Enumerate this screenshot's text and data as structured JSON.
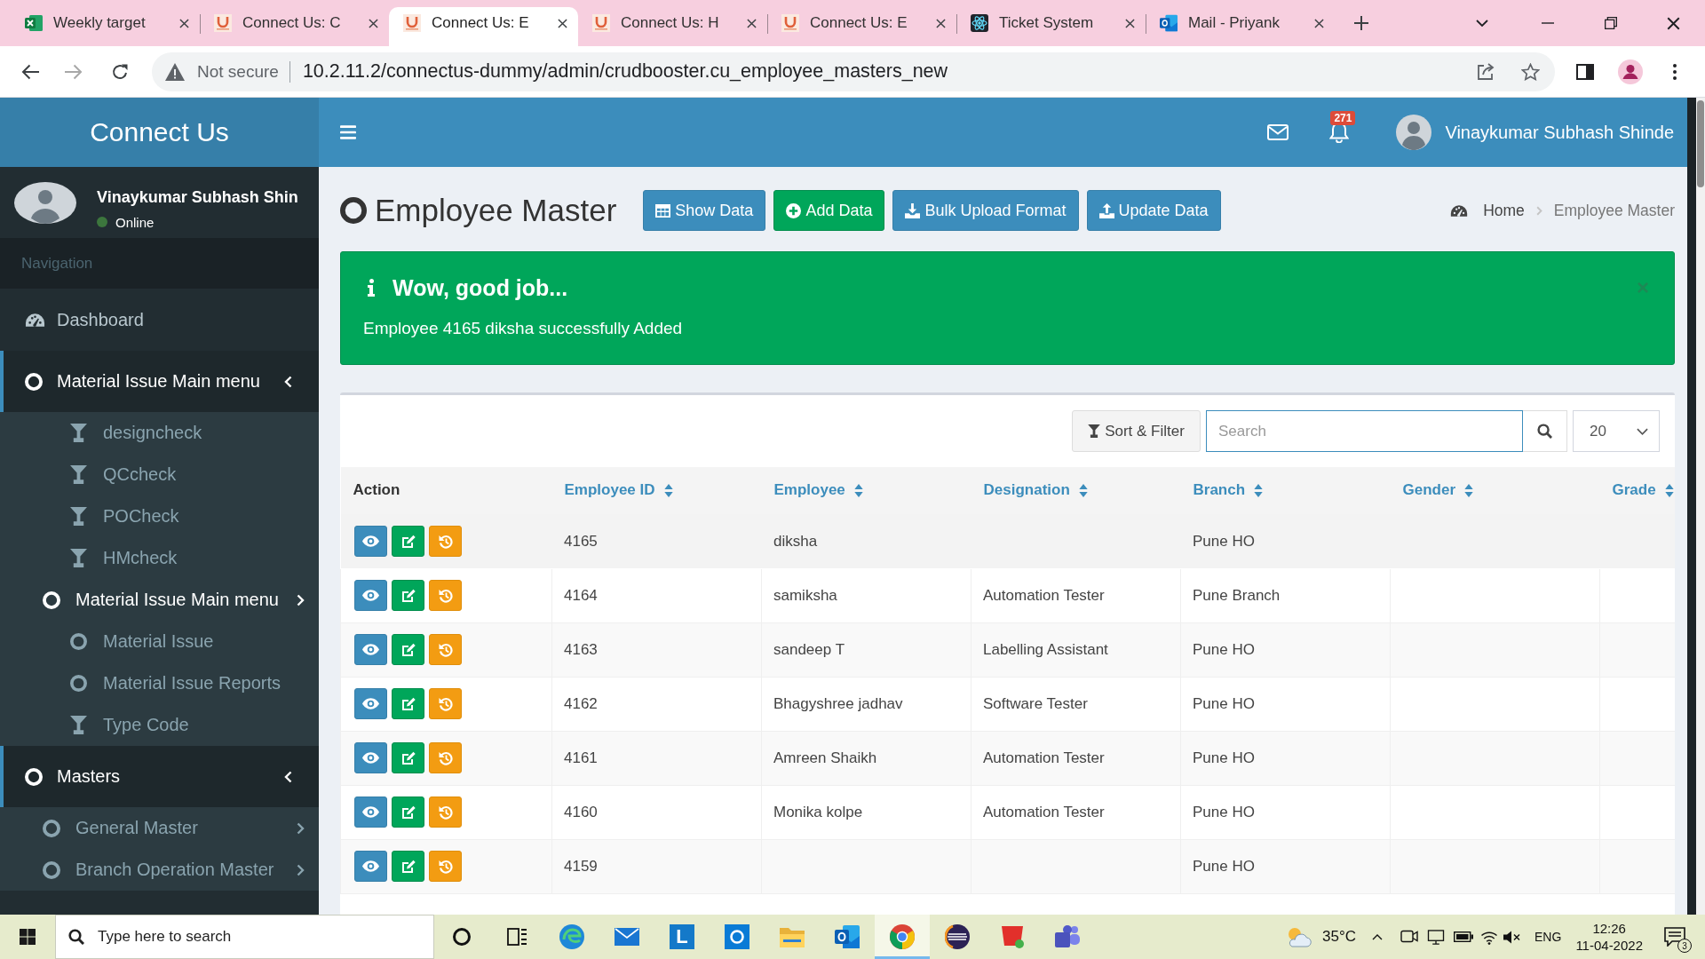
{
  "browser": {
    "tabs": [
      {
        "title": "Weekly target",
        "kind": "sheet",
        "selected": false
      },
      {
        "title": "Connect Us: C",
        "kind": "portal",
        "selected": false
      },
      {
        "title": "Connect Us: E",
        "kind": "portal",
        "selected": true
      },
      {
        "title": "Connect Us: H",
        "kind": "portal",
        "selected": false
      },
      {
        "title": "Connect Us: E",
        "kind": "portal",
        "selected": false
      },
      {
        "title": "Ticket System",
        "kind": "atom",
        "selected": false
      },
      {
        "title": "Mail - Priyank",
        "kind": "mail",
        "selected": false
      }
    ],
    "security": "Not secure",
    "url": "10.2.11.2/connectus-dummy/admin/crudbooster.cu_employee_masters_new"
  },
  "header": {
    "logo": "Connect Us",
    "user_name": "Vinaykumar Subhash Shinde",
    "notifications": "271"
  },
  "sidebar": {
    "user": {
      "name": "Vinaykumar Subhash Shin",
      "status": "Online"
    },
    "heading": "Navigation",
    "items": [
      {
        "label": "Dashboard",
        "kind": "dashboard",
        "active": false
      },
      {
        "label": "Material Issue Main menu",
        "kind": "menu",
        "active": true,
        "expanded": true,
        "children": [
          {
            "label": "designcheck",
            "kind": "filter",
            "active": false
          },
          {
            "label": "QCcheck",
            "kind": "filter",
            "active": false
          },
          {
            "label": "POCheck",
            "kind": "filter",
            "active": false
          },
          {
            "label": "HMcheck",
            "kind": "filter",
            "active": false
          },
          {
            "label": "Material Issue Main menu",
            "kind": "menu",
            "active": true,
            "expanded": false
          },
          {
            "label": "Material Issue",
            "kind": "page",
            "active": false
          },
          {
            "label": "Material Issue Reports",
            "kind": "page",
            "active": false
          },
          {
            "label": "Type Code",
            "kind": "filter",
            "active": false
          }
        ]
      },
      {
        "label": "Masters",
        "kind": "menu",
        "active": true,
        "expanded": true,
        "children": [
          {
            "label": "General Master",
            "kind": "menu",
            "active": false,
            "expanded": false
          },
          {
            "label": "Branch Operation Master",
            "kind": "menu",
            "active": false,
            "expanded": false
          }
        ]
      }
    ]
  },
  "content": {
    "title": "Employee Master",
    "actions": [
      {
        "label": "Show Data",
        "kind": "show"
      },
      {
        "label": "Add Data",
        "kind": "add"
      },
      {
        "label": "Bulk Upload Format",
        "kind": "download"
      },
      {
        "label": "Update Data",
        "kind": "upload"
      }
    ],
    "breadcrumb": [
      {
        "label": "Home",
        "kind": "link"
      },
      {
        "label": "Employee Master",
        "kind": "current"
      }
    ]
  },
  "alert": {
    "title": "Wow, good job...",
    "message": "Employee 4165 diksha successfully Added",
    "dismiss": "×"
  },
  "table": {
    "sort_filter": "Sort & Filter",
    "search": {
      "placeholder": "Search",
      "focused": true
    },
    "page_size": "20",
    "columns": [
      {
        "label": "Action",
        "sortable": false
      },
      {
        "label": "Employee ID",
        "sortable": true
      },
      {
        "label": "Employee",
        "sortable": true
      },
      {
        "label": "Designation",
        "sortable": true
      },
      {
        "label": "Branch",
        "sortable": true
      },
      {
        "label": "Gender",
        "sortable": true
      },
      {
        "label": "Grade",
        "sortable": true
      }
    ],
    "rows": [
      {
        "highlighted": true,
        "employee_id": "4165",
        "employee": "diksha",
        "branch": "Pune HO"
      },
      {
        "highlighted": false,
        "employee_id": "4164",
        "employee": "samiksha",
        "designation": "Automation Tester",
        "branch": "Pune Branch"
      },
      {
        "highlighted": false,
        "employee_id": "4163",
        "employee": "sandeep T",
        "designation": "Labelling Assistant",
        "branch": "Pune HO"
      },
      {
        "highlighted": false,
        "employee_id": "4162",
        "employee": "Bhagyshree jadhav",
        "designation": "Software Tester",
        "branch": "Pune HO"
      },
      {
        "highlighted": false,
        "employee_id": "4161",
        "employee": "Amreen Shaikh",
        "designation": "Automation Tester",
        "branch": "Pune HO"
      },
      {
        "highlighted": false,
        "employee_id": "4160",
        "employee": "Monika kolpe",
        "designation": "Automation Tester",
        "branch": "Pune HO"
      },
      {
        "highlighted": false,
        "employee_id": "4159",
        "branch": "Pune HO"
      }
    ]
  },
  "taskbar": {
    "search_placeholder": "Type here to search",
    "apps": [
      {
        "kind": "ring",
        "selected": false
      },
      {
        "kind": "tasks",
        "selected": false
      },
      {
        "kind": "swirl",
        "selected": false
      },
      {
        "kind": "envelope",
        "selected": false
      },
      {
        "kind": "tile",
        "label": "L",
        "selected": false
      },
      {
        "kind": "square",
        "selected": false
      },
      {
        "kind": "folder",
        "selected": false
      },
      {
        "kind": "mailbox",
        "selected": false
      },
      {
        "kind": "globe",
        "selected": true
      },
      {
        "kind": "sphere",
        "selected": false
      },
      {
        "kind": "shield",
        "selected": false
      },
      {
        "kind": "people",
        "selected": false
      }
    ],
    "temperature": "35°C",
    "language": "ENG",
    "time": "12:26",
    "date": "11-04-2022",
    "notifications": "3"
  }
}
